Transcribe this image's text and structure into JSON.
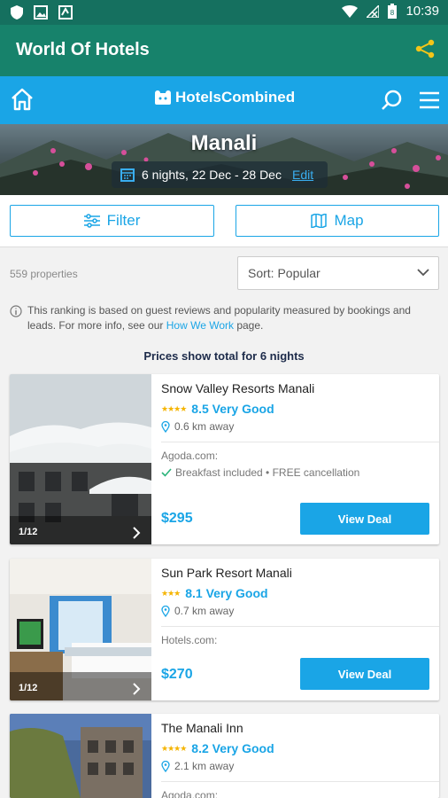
{
  "status_bar": {
    "time": "10:39"
  },
  "app": {
    "title": "World Of Hotels"
  },
  "header": {
    "logo_hotels": "Hotels",
    "logo_combined": "Combined"
  },
  "search": {
    "city": "Manali",
    "dates": "6 nights, 22 Dec - 28 Dec",
    "edit_label": "Edit"
  },
  "toolbar": {
    "filter_label": "Filter",
    "map_label": "Map"
  },
  "results": {
    "count": "559 properties",
    "sort_label": "Sort: Popular",
    "ranking_text": "This ranking is based on guest reviews and popularity measured by bookings and leads. For more info, see our ",
    "ranking_link": "How We Work",
    "ranking_suffix": " page.",
    "prices_note": "Prices show total for 6 nights"
  },
  "hotels": [
    {
      "name": "Snow Valley Resorts Manali",
      "stars": "★★★★",
      "score": "8.5 Very Good",
      "distance": "0.6 km away",
      "provider": "Agoda.com:",
      "perks": "Breakfast included • FREE cancellation",
      "price": "$295",
      "deal_label": "View Deal",
      "photo_counter": "1/12"
    },
    {
      "name": "Sun Park Resort Manali",
      "stars": "★★★",
      "score": "8.1 Very Good",
      "distance": "0.7 km away",
      "provider": "Hotels.com:",
      "price": "$270",
      "deal_label": "View Deal",
      "photo_counter": "1/12"
    },
    {
      "name": "The Manali Inn",
      "stars": "★★★★",
      "score": "8.2 Very Good",
      "distance": "2.1 km away",
      "provider": "Agoda.com:"
    }
  ],
  "colors": {
    "app_bar": "#17826b",
    "brand_blue": "#1aa5e6",
    "star": "#f5b400"
  }
}
